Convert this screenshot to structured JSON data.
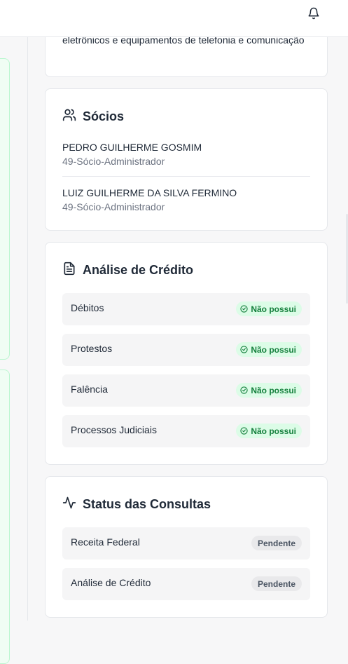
{
  "header": {
    "notification_icon": "bell-icon"
  },
  "activity": {
    "text": "eletrônicos e equipamentos de telefonia e comunicação"
  },
  "socios": {
    "title": "Sócios",
    "icon": "users-icon",
    "partners": [
      {
        "name": "PEDRO GUILHERME GOSMIM",
        "role": "49-Sócio-Administrador"
      },
      {
        "name": "LUIZ GUILHERME DA SILVA FERMINO",
        "role": "49-Sócio-Administrador"
      }
    ]
  },
  "credit": {
    "title": "Análise de Crédito",
    "icon": "document-icon",
    "status_color": "#15803d",
    "items": [
      {
        "label": "Débitos",
        "status": "Não possui"
      },
      {
        "label": "Protestos",
        "status": "Não possui"
      },
      {
        "label": "Falência",
        "status": "Não possui"
      },
      {
        "label": "Processos Judiciais",
        "status": "Não possui"
      }
    ]
  },
  "consultas": {
    "title": "Status das Consultas",
    "icon": "activity-icon",
    "items": [
      {
        "label": "Receita Federal",
        "status": "Pendente"
      },
      {
        "label": "Análise de Crédito",
        "status": "Pendente"
      }
    ]
  }
}
